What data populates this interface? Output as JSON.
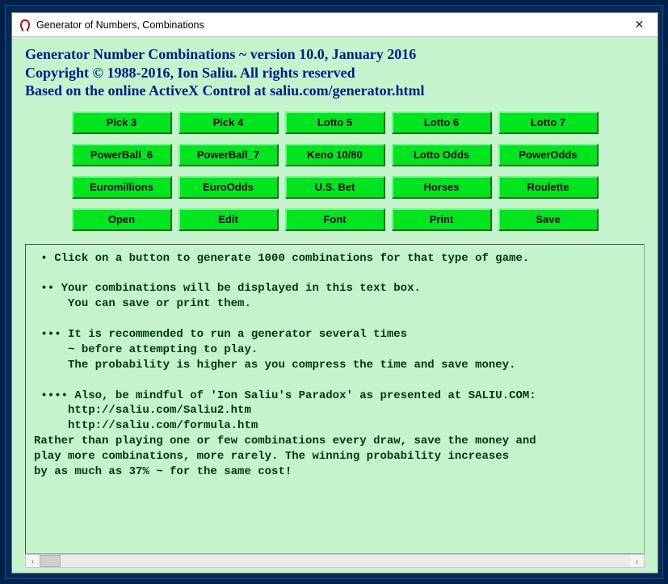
{
  "window": {
    "title": "Generator of Numbers, Combinations",
    "close_symbol": "✕"
  },
  "header": {
    "line1": "Generator Number Combinations ~ version 10.0, January 2016",
    "line2": "Copyright © 1988-2016, Ion Saliu. All rights reserved",
    "line3": "Based on the online ActiveX Control at saliu.com/generator.html"
  },
  "buttons": {
    "r0": [
      "Pick 3",
      "Pick 4",
      "Lotto 5",
      "Lotto 6",
      "Lotto 7"
    ],
    "r1": [
      "PowerBall_6",
      "PowerBall_7",
      "Keno 10/80",
      "Lotto Odds",
      "PowerOdds"
    ],
    "r2": [
      "Euromillions",
      "EuroOdds",
      "U.S. Bet",
      "Horses",
      "Roulette"
    ],
    "r3": [
      "Open",
      "Edit",
      "Font",
      "Print",
      "Save"
    ]
  },
  "textbox": {
    "content": " • Click on a button to generate 1000 combinations for that type of game.\n\n •• Your combinations will be displayed in this text box.\n     You can save or print them.\n\n ••• It is recommended to run a generator several times\n     ~ before attempting to play.\n     The probability is higher as you compress the time and save money.\n\n •••• Also, be mindful of 'Ion Saliu's Paradox' as presented at SALIU.COM:\n     http://saliu.com/Saliu2.htm\n     http://saliu.com/formula.htm\nRather than playing one or few combinations every draw, save the money and\nplay more combinations, more rarely. The winning probability increases\nby as much as 37% ~ for the same cost!"
  },
  "scroll": {
    "left": "‹",
    "right": "›"
  }
}
